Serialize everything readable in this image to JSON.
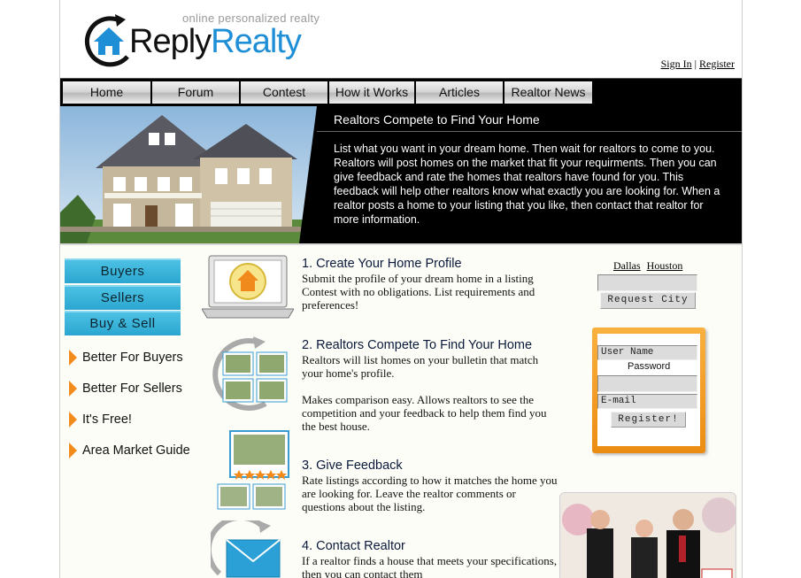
{
  "header": {
    "tagline": "online personalized realty",
    "brand_reply": "Reply",
    "brand_realty": "Realty",
    "sign_in": "Sign In",
    "separator": "|",
    "register": "Register"
  },
  "nav": [
    "Home",
    "Forum",
    "Contest",
    "How it Works",
    "Articles",
    "Realtor News"
  ],
  "hero": {
    "title": "Realtors Compete to Find Your Home",
    "text": "List what you want in your dream home. Then wait for realtors to come to you. Realtors will post homes on the market that fit your requirments. Then you can give feedback and rate the homes that realtors have found for you. This feedback will help other realtors know what exactly you are looking for. When a realtor posts a home to your listing that you like, then contact that realtor for more information."
  },
  "sidebar": {
    "buttons": [
      "Buyers",
      "Sellers",
      "Buy & Sell"
    ],
    "links": [
      "Better For Buyers",
      "Better For Sellers",
      "It's Free!",
      "Area Market Guide"
    ]
  },
  "steps": [
    {
      "title": "1. Create Your Home Profile",
      "text": "Submit the profile of your dream home in a listing Contest with no obligations. List requirements and preferences!"
    },
    {
      "title": "2. Realtors Compete To Find Your Home",
      "text": "Realtors will list homes on your bulletin that match your home's profile.",
      "text2": "Makes comparison easy. Allows realtors to see the competition and your feedback to help them find you the best house."
    },
    {
      "title": "3. Give Feedback",
      "text": "Rate listings according to how it matches the home you are looking for. Leave the realtor comments or questions about the listing."
    },
    {
      "title": "4. Contact Realtor",
      "text": "If a realtor finds a house that meets your specifications, then you can contact them"
    }
  ],
  "right": {
    "cities": [
      "Dallas",
      "Houston"
    ],
    "city_input": "",
    "request_city": "Request City",
    "username_placeholder": "User Name",
    "password_label": "Password",
    "password_value": "",
    "email_placeholder": "E-mail",
    "register_button": "Register!"
  },
  "colors": {
    "brand_blue": "#1e8fd6",
    "accent_orange": "#f28a1c",
    "category_blue": "#2ba6d0"
  }
}
